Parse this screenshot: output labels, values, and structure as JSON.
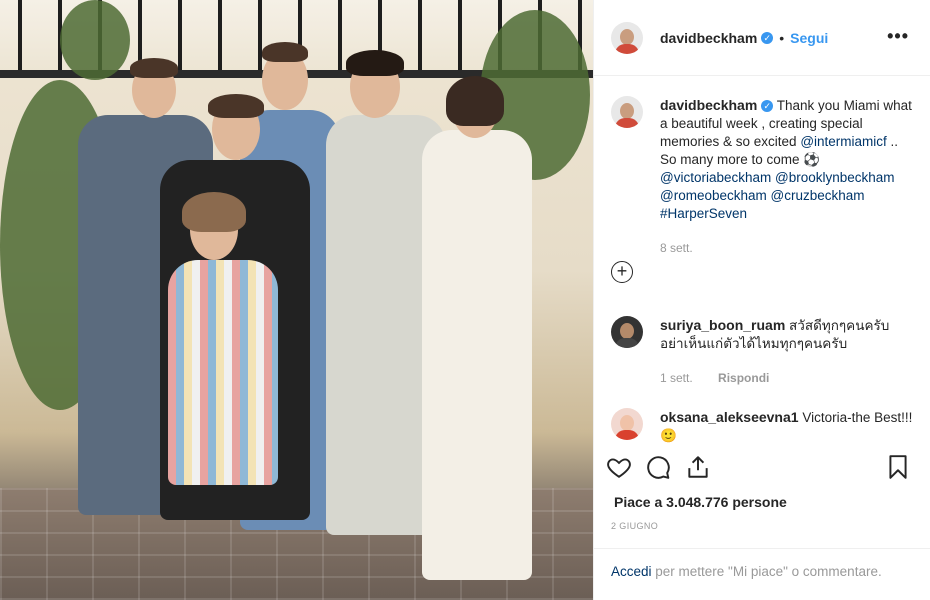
{
  "post": {
    "username": "davidbeckham",
    "dot": "•",
    "follow_label": "Segui",
    "more_label": "•••",
    "photo_alt": "Family photo in Miami"
  },
  "caption": {
    "username": "davidbeckham",
    "text_1": "Thank you Miami what a beautiful week , creating special memories & so excited ",
    "tag_1": "@intermiamicf",
    "text_2": " .. So many more to come ⚽",
    "tag_2": "@victoriabeckham",
    "tag_3": "@brooklynbeckham",
    "tag_4": "@romeobeckham",
    "tag_5": "@cruzbeckham",
    "tag_6": "#HarperSeven",
    "time": "8 sett."
  },
  "load_more_icon": "plus-circle-icon",
  "comments": [
    {
      "username": "suriya_boon_ruam",
      "text": "สวัสดีทุกๆคนครับ อย่าเห็นแก่ตัวได้ไหมทุกๆคนครับ",
      "time": "1 sett.",
      "reply_label": "Rispondi"
    },
    {
      "username": "oksana_alekseevna1",
      "text": "Victoria-the Best!!!🙂"
    }
  ],
  "actions": {
    "like_icon": "heart-icon",
    "comment_icon": "comment-icon",
    "share_icon": "share-icon",
    "save_icon": "bookmark-icon"
  },
  "likes": {
    "text": "Piace a 3.048.776 persone"
  },
  "date": "2 GIUGNO",
  "login": {
    "link": "Accedi",
    "text": " per mettere \"Mi piace\" o commentare."
  },
  "colors": {
    "link": "#003569",
    "accent": "#3897f0",
    "muted": "#999999"
  }
}
